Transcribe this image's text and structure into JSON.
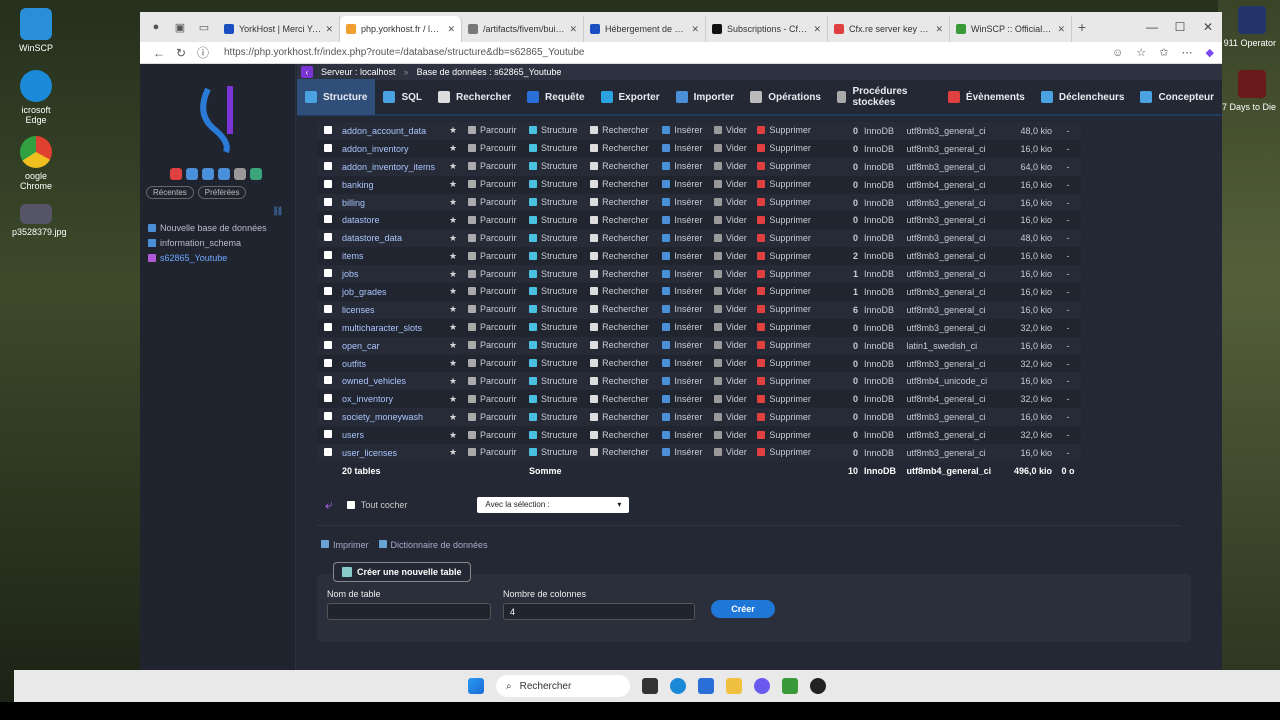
{
  "desktop": {
    "icons": [
      "WinSCP",
      "icrosoft Edge",
      "oogle Chrome",
      "p3528379.jpg"
    ],
    "right_labels": [
      "911 Operator",
      "7 Days to Die"
    ]
  },
  "browser": {
    "tabs": [
      {
        "title": "YorkHost | Merci YorkHo",
        "color": "#1a4fbf"
      },
      {
        "title": "php.yorkhost.fr / localho",
        "color": "#f0a030",
        "active": true
      },
      {
        "title": "/artifacts/fivem/build_sr",
        "color": "#777"
      },
      {
        "title": "Hébergement de serveu",
        "color": "#1a4fbf"
      },
      {
        "title": "Subscriptions - Cfx.re Pl",
        "color": "#111"
      },
      {
        "title": "Cfx.re server key manag",
        "color": "#e04040"
      },
      {
        "title": "WinSCP :: Official Site :",
        "color": "#3a9a3a"
      }
    ],
    "url": "https://php.yorkhost.fr/index.php?route=/database/structure&db=s62865_Youtube"
  },
  "sidebar": {
    "pills": [
      "Récentes",
      "Préférées"
    ],
    "tree": [
      {
        "label": "Nouvelle base de données",
        "selected": false
      },
      {
        "label": "information_schema",
        "selected": false
      },
      {
        "label": "s62865_Youtube",
        "selected": true
      }
    ]
  },
  "breadcrumb": {
    "server": "Serveur : localhost",
    "database": "Base de données : s62865_Youtube"
  },
  "menu": [
    {
      "label": "Structure",
      "active": true,
      "color": "#4aa3e0"
    },
    {
      "label": "SQL",
      "color": "#4aa3e0"
    },
    {
      "label": "Rechercher",
      "color": "#dddddd"
    },
    {
      "label": "Requête",
      "color": "#2a6fd8"
    },
    {
      "label": "Exporter",
      "color": "#2aa3e0"
    },
    {
      "label": "Importer",
      "color": "#4a8fd8"
    },
    {
      "label": "Opérations",
      "color": "#bbbbbb"
    },
    {
      "label": "Procédures stockées",
      "color": "#aaaaaa"
    },
    {
      "label": "Évènements",
      "color": "#e04040"
    },
    {
      "label": "Déclencheurs",
      "color": "#4aa3e0"
    },
    {
      "label": "Concepteur",
      "color": "#4aa3e0"
    }
  ],
  "actions": {
    "browse": "Parcourir",
    "structure": "Structure",
    "search": "Rechercher",
    "insert": "Insérer",
    "empty": "Vider",
    "drop": "Supprimer"
  },
  "tables": [
    {
      "name": "addon_account_data",
      "rows": "0",
      "engine": "InnoDB",
      "collation": "utf8mb3_general_ci",
      "size": "48,0 kio",
      "overhead": "-"
    },
    {
      "name": "addon_inventory",
      "rows": "0",
      "engine": "InnoDB",
      "collation": "utf8mb3_general_ci",
      "size": "16,0 kio",
      "overhead": "-"
    },
    {
      "name": "addon_inventory_items",
      "rows": "0",
      "engine": "InnoDB",
      "collation": "utf8mb3_general_ci",
      "size": "64,0 kio",
      "overhead": "-"
    },
    {
      "name": "banking",
      "rows": "0",
      "engine": "InnoDB",
      "collation": "utf8mb4_general_ci",
      "size": "16,0 kio",
      "overhead": "-"
    },
    {
      "name": "billing",
      "rows": "0",
      "engine": "InnoDB",
      "collation": "utf8mb3_general_ci",
      "size": "16,0 kio",
      "overhead": "-"
    },
    {
      "name": "datastore",
      "rows": "0",
      "engine": "InnoDB",
      "collation": "utf8mb3_general_ci",
      "size": "16,0 kio",
      "overhead": "-"
    },
    {
      "name": "datastore_data",
      "rows": "0",
      "engine": "InnoDB",
      "collation": "utf8mb3_general_ci",
      "size": "48,0 kio",
      "overhead": "-"
    },
    {
      "name": "items",
      "rows": "2",
      "engine": "InnoDB",
      "collation": "utf8mb3_general_ci",
      "size": "16,0 kio",
      "overhead": "-"
    },
    {
      "name": "jobs",
      "rows": "1",
      "engine": "InnoDB",
      "collation": "utf8mb3_general_ci",
      "size": "16,0 kio",
      "overhead": "-"
    },
    {
      "name": "job_grades",
      "rows": "1",
      "engine": "InnoDB",
      "collation": "utf8mb3_general_ci",
      "size": "16,0 kio",
      "overhead": "-"
    },
    {
      "name": "licenses",
      "rows": "6",
      "engine": "InnoDB",
      "collation": "utf8mb3_general_ci",
      "size": "16,0 kio",
      "overhead": "-"
    },
    {
      "name": "multicharacter_slots",
      "rows": "0",
      "engine": "InnoDB",
      "collation": "utf8mb3_general_ci",
      "size": "32,0 kio",
      "overhead": "-"
    },
    {
      "name": "open_car",
      "rows": "0",
      "engine": "InnoDB",
      "collation": "latin1_swedish_ci",
      "size": "16,0 kio",
      "overhead": "-"
    },
    {
      "name": "outfits",
      "rows": "0",
      "engine": "InnoDB",
      "collation": "utf8mb3_general_ci",
      "size": "32,0 kio",
      "overhead": "-"
    },
    {
      "name": "owned_vehicles",
      "rows": "0",
      "engine": "InnoDB",
      "collation": "utf8mb4_unicode_ci",
      "size": "16,0 kio",
      "overhead": "-"
    },
    {
      "name": "ox_inventory",
      "rows": "0",
      "engine": "InnoDB",
      "collation": "utf8mb4_general_ci",
      "size": "32,0 kio",
      "overhead": "-"
    },
    {
      "name": "society_moneywash",
      "rows": "0",
      "engine": "InnoDB",
      "collation": "utf8mb3_general_ci",
      "size": "16,0 kio",
      "overhead": "-"
    },
    {
      "name": "users",
      "rows": "0",
      "engine": "InnoDB",
      "collation": "utf8mb3_general_ci",
      "size": "32,0 kio",
      "overhead": "-"
    },
    {
      "name": "user_licenses",
      "rows": "0",
      "engine": "InnoDB",
      "collation": "utf8mb3_general_ci",
      "size": "16,0 kio",
      "overhead": "-"
    }
  ],
  "footer": {
    "count": "20 tables",
    "sum": "Somme",
    "rows": "10",
    "engine": "InnoDB",
    "collation": "utf8mb4_general_ci",
    "size": "496,0 kio",
    "overhead": "0 o"
  },
  "selection": {
    "check_all": "Tout cocher",
    "select_placeholder": "Avec la sélection :"
  },
  "links": {
    "print": "Imprimer",
    "dictionary": "Dictionnaire de données"
  },
  "create": {
    "button": "Créer une nouvelle table",
    "name_label": "Nom de table",
    "name_value": "",
    "cols_label": "Nombre de colonnes",
    "cols_value": "4",
    "submit": "Créer"
  },
  "taskbar": {
    "search": "Rechercher"
  }
}
